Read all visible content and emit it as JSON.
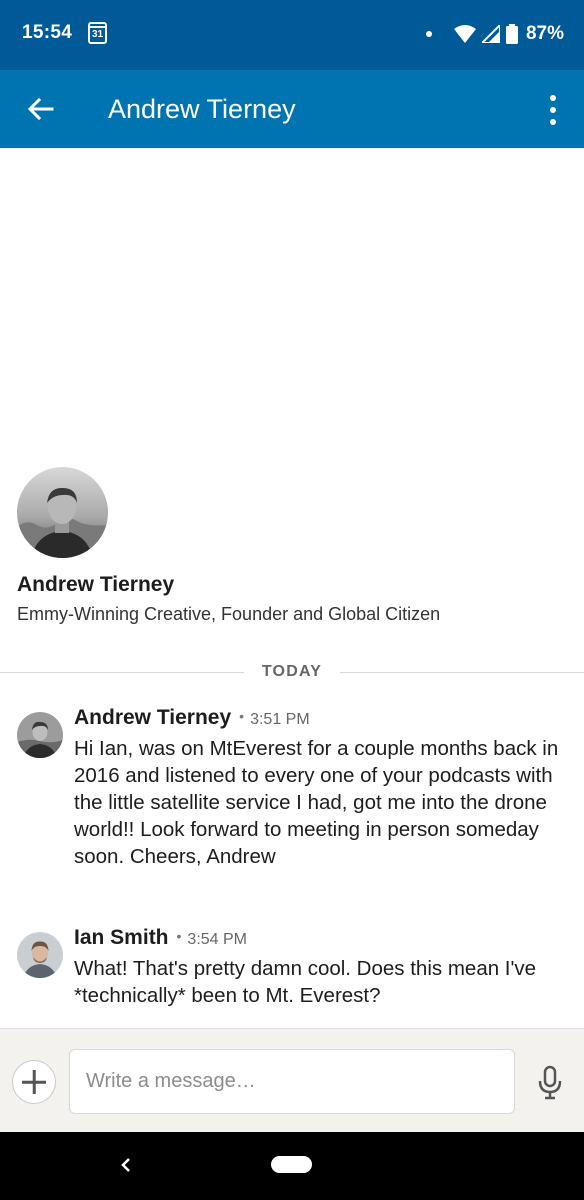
{
  "status_bar": {
    "time": "15:54",
    "calendar_day": "31",
    "battery": "87%"
  },
  "app_bar": {
    "title": "Andrew Tierney",
    "color": "#0073b1"
  },
  "profile": {
    "name": "Andrew Tierney",
    "headline": "Emmy-Winning Creative, Founder and Global Citizen"
  },
  "divider_label": "TODAY",
  "messages": [
    {
      "sender": "Andrew Tierney",
      "separator": "•",
      "time": "3:51 PM",
      "text": "Hi Ian, was on MtEverest for a couple months back in 2016 and listened to every one of your podcasts with the little satellite service I had, got me into the drone world!! Look forward to meeting in person someday soon. Cheers, Andrew"
    },
    {
      "sender": "Ian Smith",
      "separator": "•",
      "time": "3:54 PM",
      "text": "What! That's pretty damn cool. Does this mean I've *technically* been to Mt. Everest?"
    }
  ],
  "composer": {
    "placeholder": "Write a message…"
  }
}
